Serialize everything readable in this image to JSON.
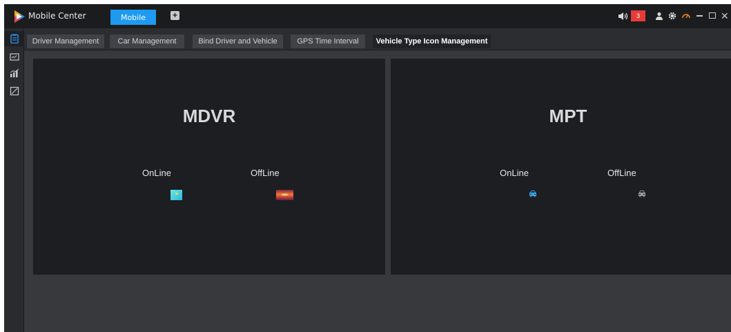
{
  "titlebar": {
    "app_title": "Mobile Center",
    "mode_button": "Mobile",
    "add_tab": "+",
    "alarm_count": "3",
    "colors": {
      "accent": "#1e9af1",
      "alarm": "#e63b3b"
    },
    "icons": [
      "logo-icon",
      "sound-icon",
      "user-icon",
      "gear-icon",
      "speedometer-icon",
      "minimize-icon",
      "maximize-icon",
      "close-icon"
    ]
  },
  "sidebar": {
    "items": [
      {
        "name": "clipboard-icon",
        "active": true
      },
      {
        "name": "monitor-icon",
        "active": false
      },
      {
        "name": "chart-icon",
        "active": false
      },
      {
        "name": "edit-icon",
        "active": false
      }
    ]
  },
  "tabs": [
    {
      "label": "Driver Management",
      "active": false
    },
    {
      "label": "Car Management",
      "active": false
    },
    {
      "label": "Bind Driver and Vehicle",
      "active": false
    },
    {
      "label": "GPS Time Interval",
      "active": false
    },
    {
      "label": "Vehicle Type Icon Management",
      "active": true
    }
  ],
  "panels": [
    {
      "title": "MDVR",
      "online_label": "OnLine",
      "offline_label": "OffLine",
      "online_icon": "cyan-square-icon",
      "offline_icon": "sunset-image-icon"
    },
    {
      "title": "MPT",
      "online_label": "OnLine",
      "offline_label": "OffLine",
      "online_icon": "car-online-icon",
      "offline_icon": "car-offline-icon",
      "online_color": "#3aa6ee",
      "offline_color": "#9a9a9a"
    }
  ]
}
